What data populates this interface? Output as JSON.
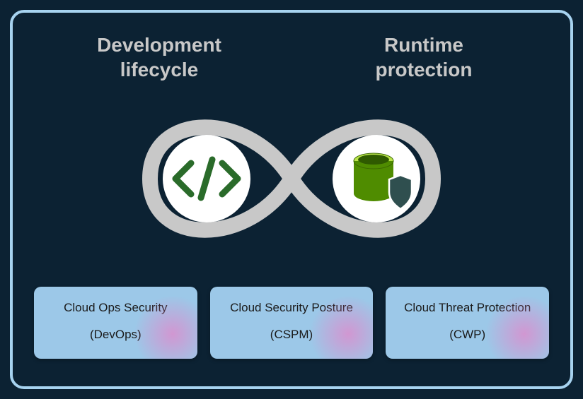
{
  "headings": {
    "left": "Development\nlifecycle",
    "right": "Runtime\nprotection"
  },
  "icons": {
    "left": "code-icon",
    "right": "database-shield-icon"
  },
  "cards": [
    {
      "title": "Cloud Ops Security",
      "sub": "(DevOps)"
    },
    {
      "title": "Cloud Security Posture",
      "sub": "(CSPM)"
    },
    {
      "title": "Cloud Threat Protection",
      "sub": "(CWP)"
    }
  ],
  "colors": {
    "frame_border": "#a7d3f0",
    "background": "#0c2233",
    "heading_text": "#c8c8c8",
    "card_bg": "#9cc8e8",
    "infinity_stroke": "#c8c8c8",
    "code_green": "#2a6b2a",
    "db_green": "#7fb500",
    "shield_dark": "#2f4f4f"
  }
}
